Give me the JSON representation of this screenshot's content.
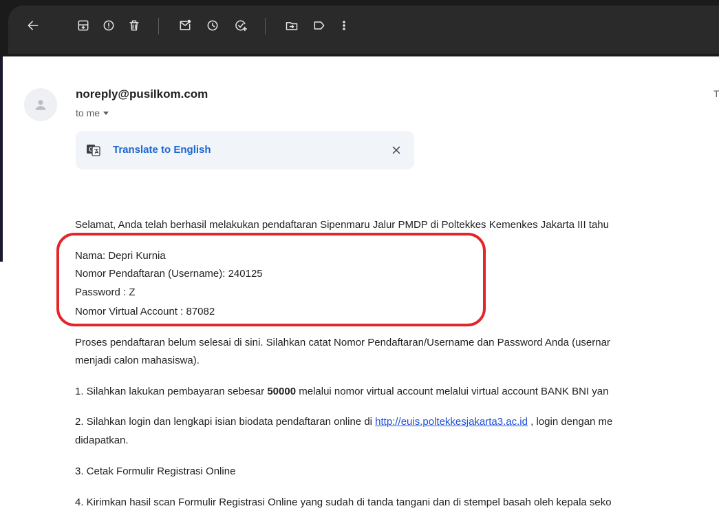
{
  "toolbar": {
    "icons": [
      "back-arrow-icon",
      "archive-icon",
      "report-spam-icon",
      "delete-icon",
      "mark-unread-icon",
      "snooze-icon",
      "add-to-tasks-icon",
      "move-to-icon",
      "label-icon",
      "more-vert-icon"
    ]
  },
  "email": {
    "sender": "noreply@pusilkom.com",
    "recipient": "to me",
    "right_char": "T",
    "translate_label": "Translate to English",
    "intro": "Selamat, Anda telah berhasil melakukan pendaftaran Sipenmaru Jalur PMDP di Poltekkes Kemenkes Jakarta III tahu",
    "info": {
      "nama": "Nama: Depri           Kurnia",
      "nomor_pendaftaran": "Nomor Pendaftaran (Username): 240125",
      "password": "Password : Z",
      "virtual_account": "Nomor Virtual Account : 87082"
    },
    "process_line1": "Proses pendaftaran belum selesai di sini. Silahkan catat Nomor Pendaftaran/Username dan Password Anda (usernar",
    "process_line2": "menjadi calon mahasiswa).",
    "step1_pre": "1. Silahkan lakukan pembayaran sebesar ",
    "step1_amount": "50000",
    "step1_post": " melalui nomor virtual account melalui virtual account BANK BNI yan",
    "step2_pre": "2. Silahkan login dan lengkapi isian biodata pendaftaran online di ",
    "step2_link": "http://euis.poltekkesjakarta3.ac.id",
    "step2_post": " , login dengan me",
    "step2_line2": "didapatkan.",
    "step3": "3. Cetak Formulir Registrasi Online",
    "step4": "4. Kirimkan hasil scan Formulir Registrasi Online yang sudah di tanda tangani dan di stempel basah oleh kepala seko"
  },
  "colors": {
    "highlight_border": "#e3262b",
    "link": "#1a4fd6",
    "translate_link": "#1a67d2"
  }
}
